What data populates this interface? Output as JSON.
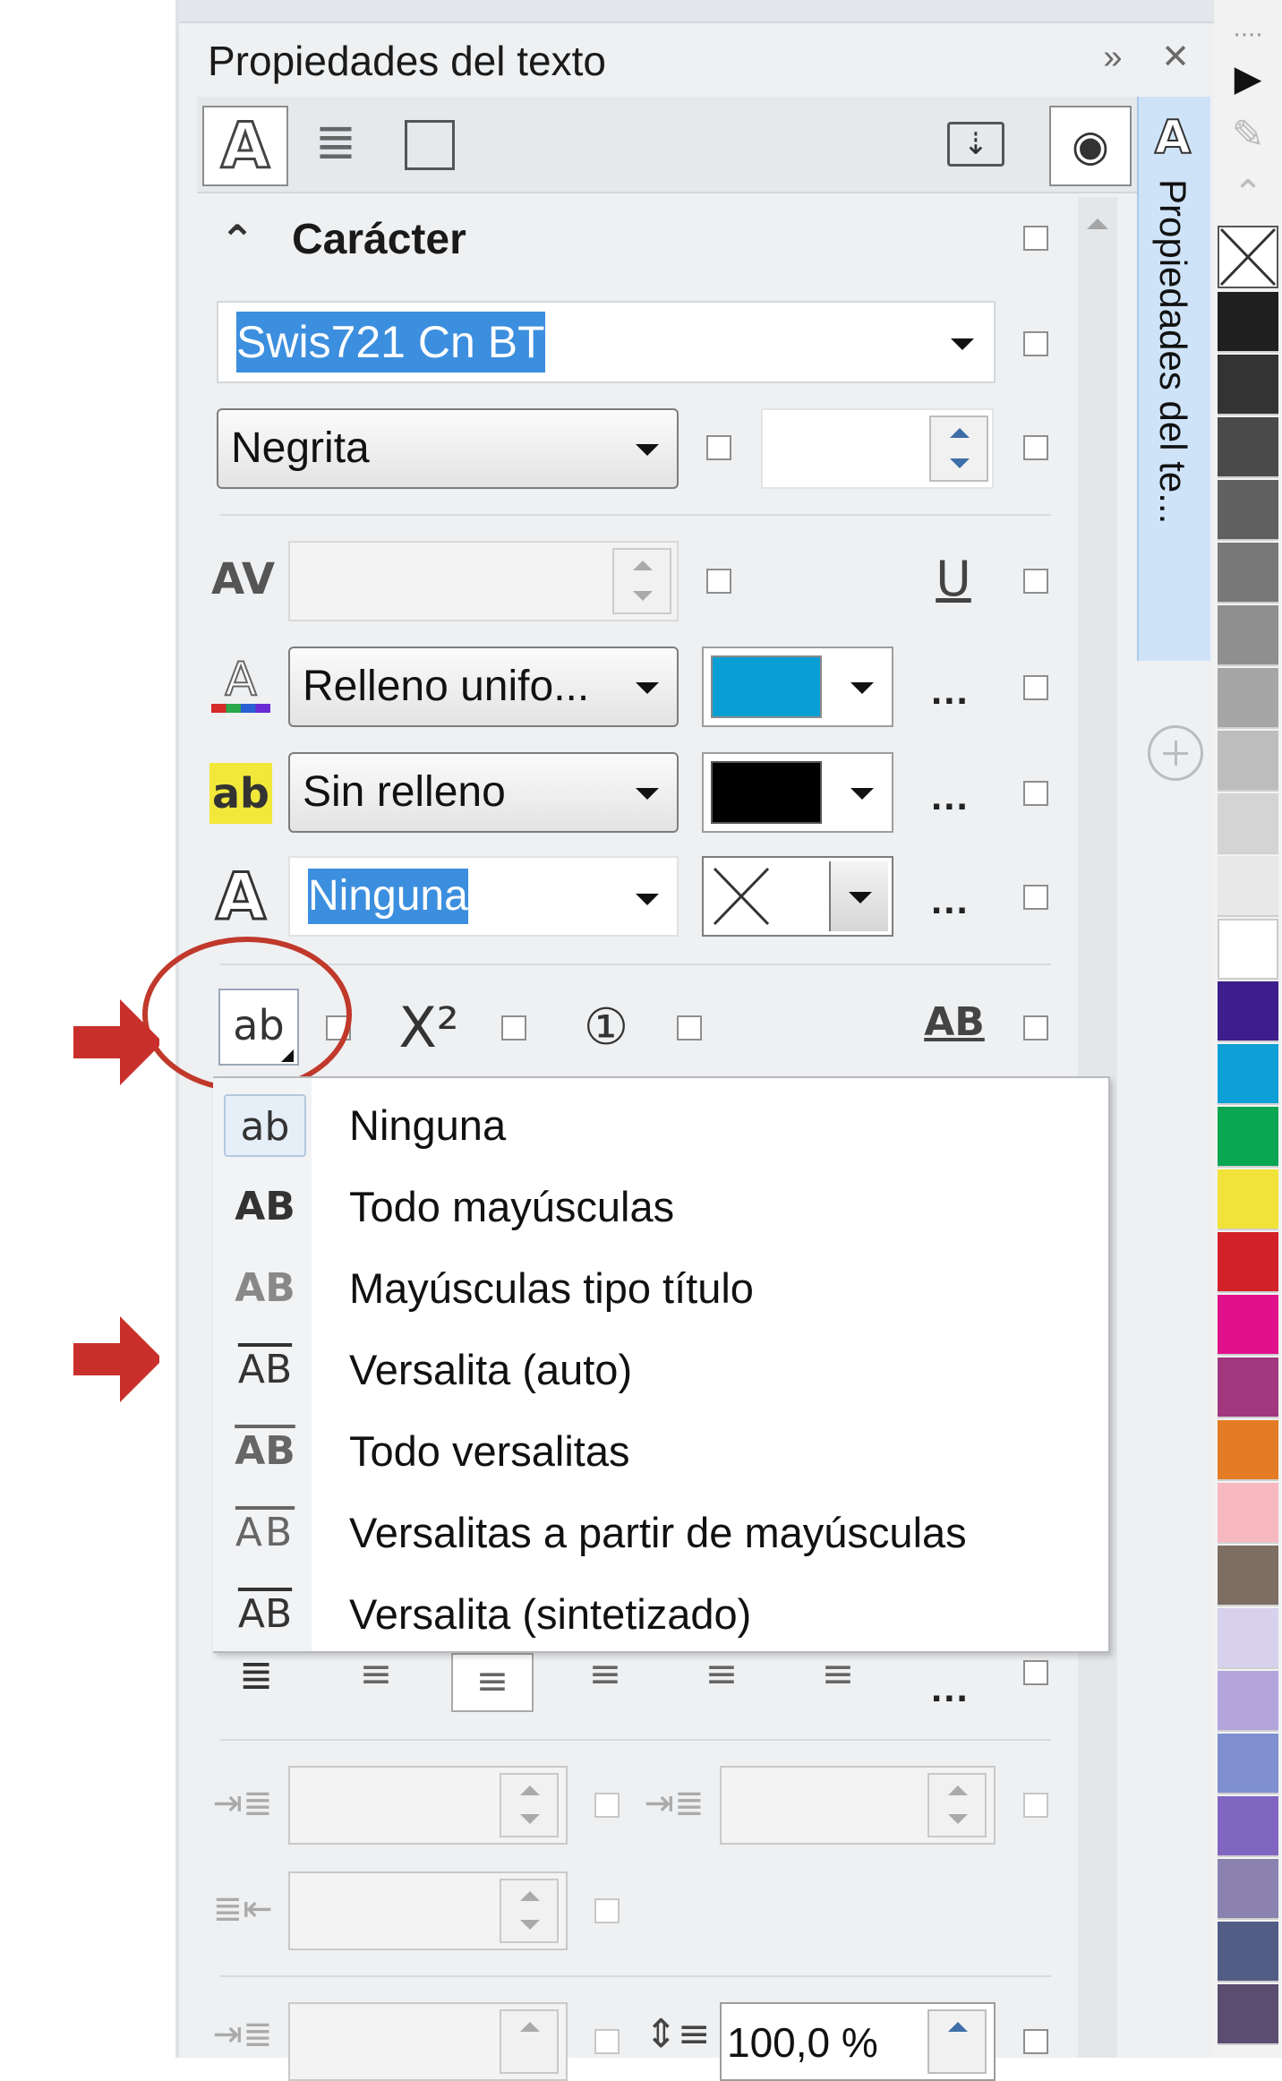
{
  "panel": {
    "title": "Propiedades del texto",
    "title_buttons": [
      "expand-icon",
      "close-icon"
    ],
    "side_tab_label": "Propiedades del te...",
    "add_tab_icon": "plus-circle-icon"
  },
  "section": {
    "title": "Carácter",
    "font_name": "Swis721 Cn BT",
    "font_style": "Negrita",
    "font_size": "",
    "kerning": "",
    "fill_type": "Relleno unifo...",
    "fill_color": "#0a9fd4",
    "background_fill": "Sin relleno",
    "background_color": "#000000",
    "outline": "Ninguna",
    "more": "..."
  },
  "case_button": {
    "label": "ab"
  },
  "menu": {
    "items": [
      {
        "icon": "ab",
        "label": "Ninguna",
        "selected": true
      },
      {
        "icon": "AB",
        "label": "Todo mayúsculas"
      },
      {
        "icon": "AB",
        "label": "Mayúsculas tipo título"
      },
      {
        "icon": "AB",
        "label": "Versalita (auto)"
      },
      {
        "icon": "AB",
        "label": "Todo versalitas"
      },
      {
        "icon": "AB",
        "label": "Versalitas a partir de mayúsculas"
      },
      {
        "icon": "AB",
        "label": "Versalita (sintetizado)"
      }
    ]
  },
  "paragraph": {
    "line_spacing": "100,0 %",
    "more": "..."
  },
  "palette": {
    "colors": [
      "#1f1f1f",
      "#333333",
      "#4a4a4a",
      "#606060",
      "#787878",
      "#8f8f8f",
      "#a6a6a6",
      "#bdbdbd",
      "#d4d4d4",
      "#e8e8e8",
      "#ffffff",
      "#3d1e8c",
      "#0d9fd6",
      "#0aa651",
      "#f1e33a",
      "#d3212a",
      "#e0118a",
      "#a1377f",
      "#e37c24",
      "#f8b8c0",
      "#7d6e63",
      "#d7d1ee",
      "#b3a4dc",
      "#7f8fd0",
      "#8166c1",
      "#8b82b0",
      "#525d86",
      "#5a4d70"
    ]
  }
}
